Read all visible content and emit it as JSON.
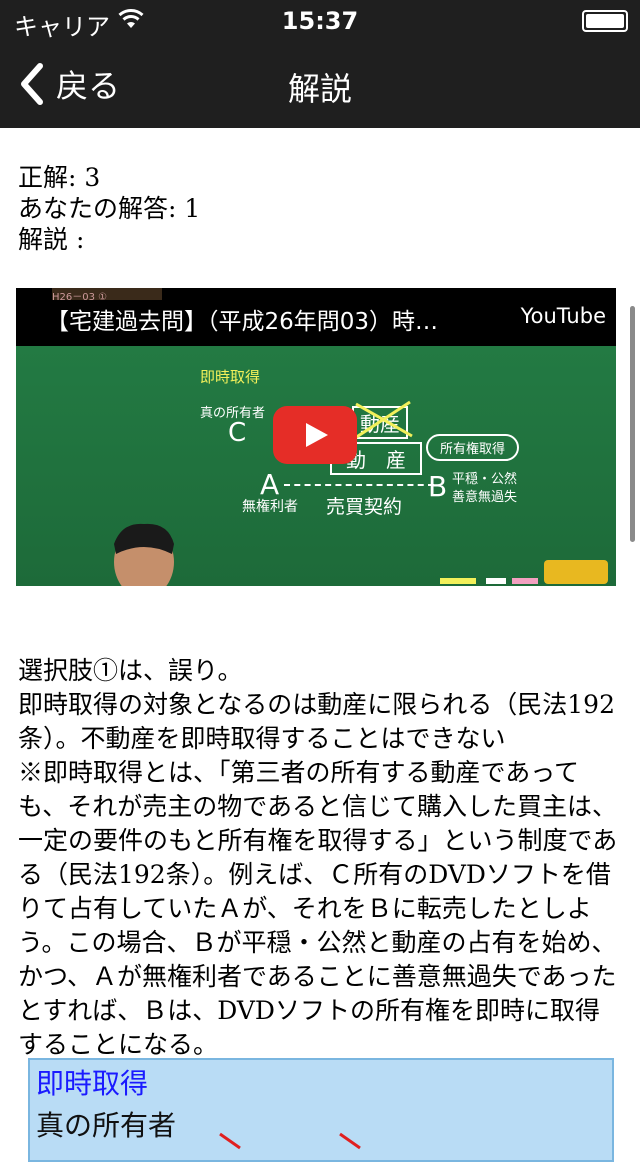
{
  "status_bar": {
    "carrier": "キャリア",
    "time": "15:37"
  },
  "nav": {
    "back_label": "戻る",
    "title": "解説"
  },
  "answer": {
    "correct": "正解: 3",
    "yours": "あなたの解答: 1",
    "explanation_label": "解説 :"
  },
  "video": {
    "title": "【宅建過去問】（平成26年問03）時…",
    "brand": "YouTube",
    "stamp": "H26－03 ①",
    "board": {
      "heading": "即時取得",
      "owner_label": "真の所有者",
      "c": "C",
      "a": "A",
      "b": "B",
      "movable1": "動産",
      "movable2": "動　産",
      "no_right": "無権利者",
      "sale": "売買契約",
      "acquire": "所有権取得",
      "calm": "平穏・公然",
      "good_faith": "善意無過失"
    }
  },
  "body": {
    "p1": "選択肢①は、誤り。",
    "p2": "即時取得の対象となるのは動産に限られる（民法192条）。不動産を即時取得することはできない",
    "p3": "※即時取得とは、「第三者の所有する動産であっても、それが売主の物であると信じて購入した買主は、一定の要件のもと所有権を取得する」という制度である（民法192条）。例えば、Ｃ所有のDVDソフトを借りて占有していたＡが、それをＢに転売したとしよう。この場合、Ｂが平穏・公然と動産の占有を始め、かつ、Ａが無権利者であることに善意無過失であったとすれば、Ｂは、DVDソフトの所有権を即時に取得することになる。"
  },
  "figure": {
    "title": "即時取得",
    "owner": "真の所有者"
  },
  "colors": {
    "bar": "#1f1f1f",
    "board": "#237a43",
    "play": "#e52d27",
    "figure_bg": "#b9dcf5",
    "figure_title": "#1a1aff"
  }
}
